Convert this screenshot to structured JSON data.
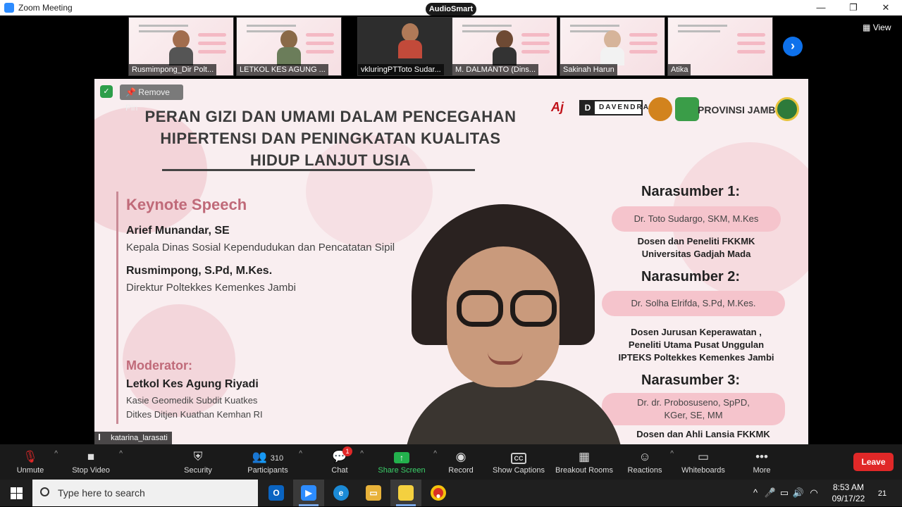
{
  "window": {
    "title": "Zoom Meeting",
    "plugin": "AudioSmart",
    "minimize": "—",
    "restore": "❐",
    "close": "✕",
    "view_label": "View"
  },
  "gallery": {
    "participants": [
      {
        "name": "Rusmimpong_Dir Polt..."
      },
      {
        "name": "LETKOL KES AGUNG ..."
      },
      {
        "name": "vkluringPTToto Sudar..."
      },
      {
        "name": "M. DALMANTO (Dins..."
      },
      {
        "name": "Sakinah Harun"
      },
      {
        "name": "Atika"
      }
    ],
    "next_icon": "chevron-right-icon"
  },
  "main_view": {
    "remove_pin": "Remove Pin",
    "slide": {
      "title_lines": [
        "PERAN GIZI DAN UMAMI DALAM PENCEGAHAN",
        "HIPERTENSI DAN PENINGKATAN KUALITAS",
        "HIDUP LANJUT USIA"
      ],
      "logos": {
        "aj": "Aj",
        "davendra": "DAVENDRA",
        "davendra_d": "D",
        "jambi": "PROVINSI JAMBI"
      },
      "keynote_heading": "Keynote Speech",
      "keynote1_name": "Arief Munandar, SE",
      "keynote1_role": "Kepala Dinas Sosial Kependudukan dan Pencatatan Sipil",
      "keynote2_name": "Rusmimpong, S.Pd, M.Kes.",
      "keynote2_role": "Direktur Poltekkes Kemenkes Jambi",
      "moderator_heading": "Moderator:",
      "moderator_name": "Letkol Kes Agung Riyadi",
      "moderator_role1": "Kasie Geomedik Subdit Kuatkes",
      "moderator_role2": "Ditkes Ditjen Kuathan Kemhan RI",
      "narasumber": [
        {
          "heading": "Narasumber 1:",
          "name": "Dr. Toto Sudargo, SKM, M.Kes",
          "desc1": "Dosen dan Peneliti FKKMK",
          "desc2": "Universitas Gadjah Mada",
          "desc3": ""
        },
        {
          "heading": "Narasumber 2:",
          "name": "Dr. Solha Elrifda, S.Pd, M.Kes.",
          "desc1": "Dosen Jurusan Keperawatan ,",
          "desc2": "Peneliti Utama Pusat Unggulan",
          "desc3": "IPTEKS Poltekkes Kemenkes Jambi"
        },
        {
          "heading": "Narasumber 3:",
          "name_line1": "Dr. dr. Probosuseno, SpPD,",
          "name_line2": "KGer, SE, MM",
          "desc1": "Dosen dan Ahli Lansia FKKMK"
        }
      ]
    },
    "speaker_name": "katarina_larasati"
  },
  "toolbar": {
    "unmute": "Unmute",
    "stop_video": "Stop Video",
    "security": "Security",
    "participants": "Participants",
    "participants_count": "310",
    "chat": "Chat",
    "chat_badge": "1",
    "share_screen": "Share Screen",
    "record": "Record",
    "show_captions": "Show Captions",
    "cc": "CC",
    "breakout_rooms": "Breakout Rooms",
    "reactions": "Reactions",
    "whiteboards": "Whiteboards",
    "more": "More",
    "leave": "Leave",
    "accent": "#3bd06a",
    "leave_color": "#e02828"
  },
  "taskbar": {
    "search_placeholder": "Type here to search",
    "time": "8:53 AM",
    "date": "09/17/22",
    "notification_count": "21"
  }
}
